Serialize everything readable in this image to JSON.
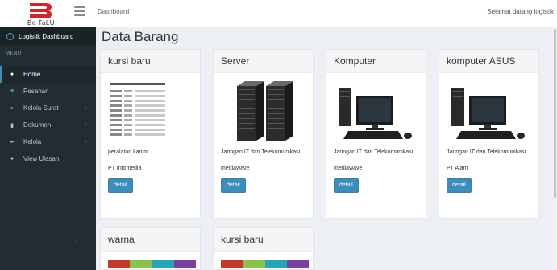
{
  "header": {
    "logo_text": "Be TaLU",
    "breadcrumb": "Dashboard",
    "welcome": "Selamat datang logistik"
  },
  "sidebar": {
    "title": "Logistik Dashboard",
    "menu_label": "MENU",
    "items": [
      {
        "label": "Home",
        "icon": "home-icon"
      },
      {
        "label": "Pesanan",
        "icon": "list-icon"
      },
      {
        "label": "Kelola Surat",
        "icon": "pencil-icon"
      },
      {
        "label": "Dokumen",
        "icon": "document-icon"
      },
      {
        "label": "Kelola",
        "icon": "pencil-icon"
      },
      {
        "label": "View Ulasan",
        "icon": "comment-icon"
      }
    ],
    "collapse_glyph": "‹"
  },
  "main": {
    "title": "Data Barang",
    "cards": [
      {
        "title": "kursi baru",
        "image": "document-list-image",
        "category": "peralatan kantor",
        "supplier": "PT Infomedia",
        "button": "detail"
      },
      {
        "title": "Server",
        "image": "server-rack-image",
        "category": "Jaringan IT dan Telekomunikasi",
        "supplier": "mediawave",
        "button": "detail"
      },
      {
        "title": "Komputer",
        "image": "desktop-computer-image",
        "category": "Jaringan IT dan Telekomunikasi",
        "supplier": "mediawave",
        "button": "detail"
      },
      {
        "title": "komputer ASUS",
        "image": "desktop-computer-image",
        "category": "Jaringan IT dan Telekomunikasi",
        "supplier": "PT Alam",
        "button": "detail"
      },
      {
        "title": "warna",
        "image": "color-palette-image"
      },
      {
        "title": "kursi baru",
        "image": "color-palette-image"
      }
    ],
    "palette_colors": [
      "#c0392b",
      "#8bc34a",
      "#26a5b8",
      "#7b3fa0"
    ]
  },
  "colors": {
    "sidebar_bg": "#222d32",
    "accent": "#3c8dbc",
    "logo_red": "#d6232a"
  }
}
